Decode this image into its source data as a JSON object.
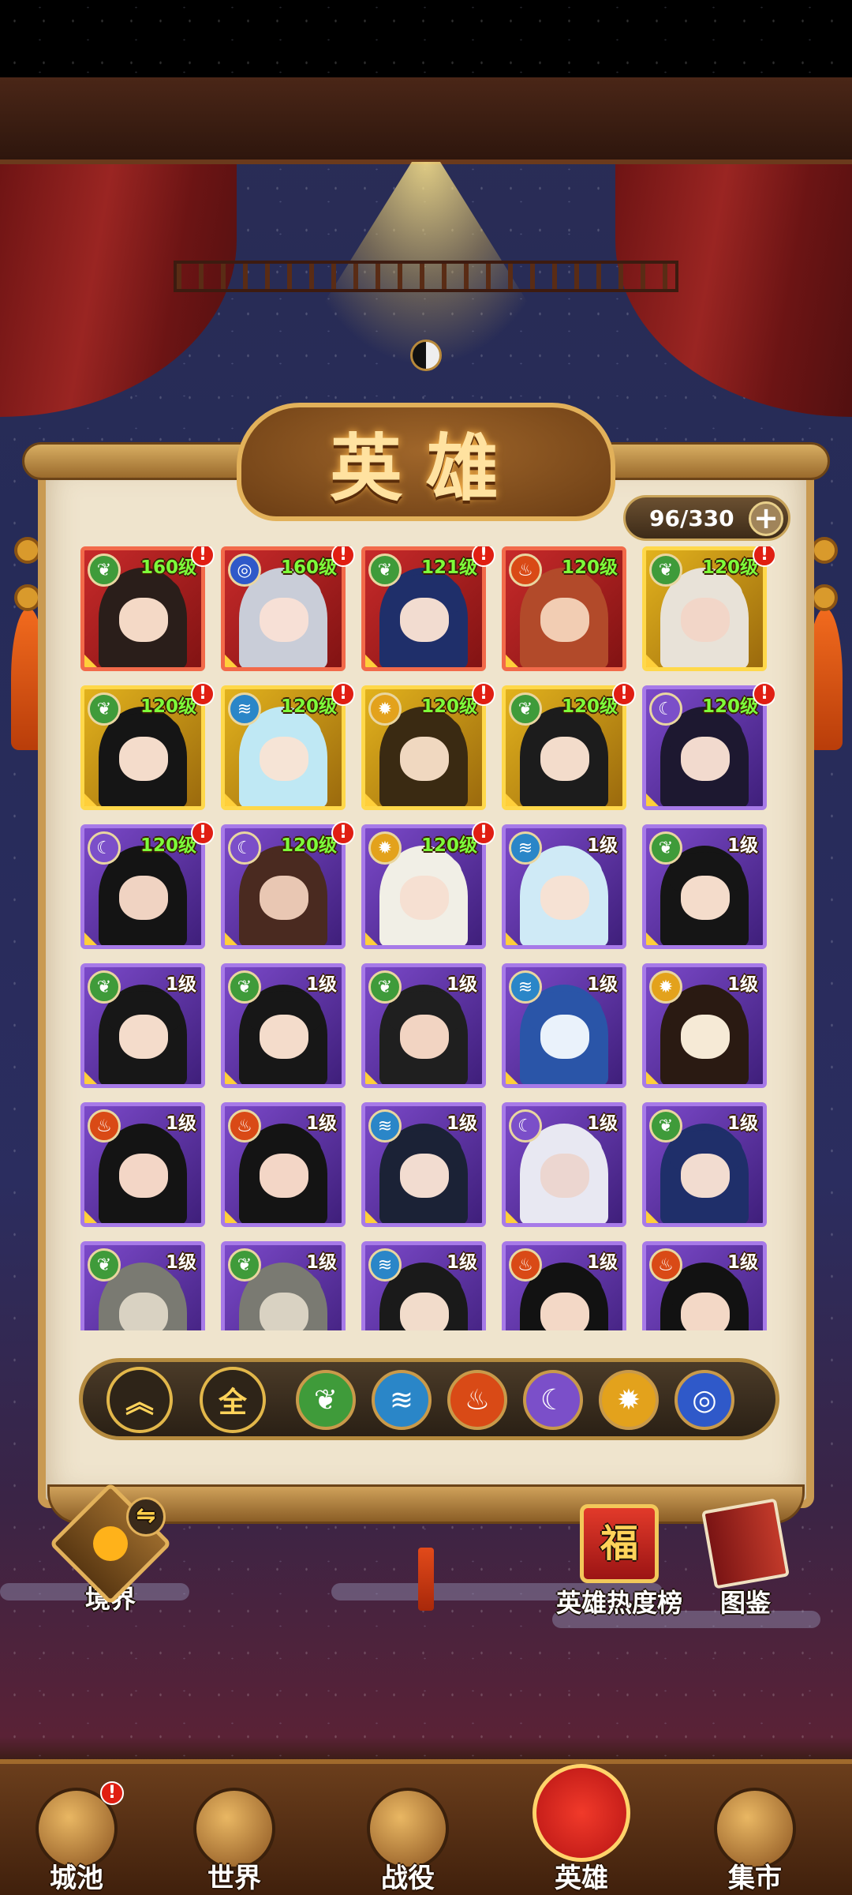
{
  "title": "英雄",
  "hero_count": "96/330",
  "add_label": "+",
  "heroes": [
    {
      "level": "160级",
      "element": "wood",
      "rarity": "red",
      "alert": true,
      "hair": "#2a1e1a",
      "skin": "#f4d9c6"
    },
    {
      "level": "160级",
      "element": "wind",
      "rarity": "red",
      "alert": true,
      "hair": "#c9cdd8",
      "skin": "#f7e0d6"
    },
    {
      "level": "121级",
      "element": "wood",
      "rarity": "red",
      "alert": true,
      "hair": "#1f2f6a",
      "skin": "#f2dcd0"
    },
    {
      "level": "120级",
      "element": "fire",
      "rarity": "red",
      "alert": false,
      "hair": "#b24a2a",
      "skin": "#f2cdb3"
    },
    {
      "level": "120级",
      "element": "wood",
      "rarity": "gold",
      "alert": true,
      "hair": "#e8e2d8",
      "skin": "#f2d6c8"
    },
    {
      "level": "120级",
      "element": "wood",
      "rarity": "gold",
      "alert": true,
      "hair": "#151515",
      "skin": "#f4dccb"
    },
    {
      "level": "120级",
      "element": "water",
      "rarity": "gold",
      "alert": true,
      "hair": "#bfe8f4",
      "skin": "#f6e4d6"
    },
    {
      "level": "120级",
      "element": "light",
      "rarity": "gold",
      "alert": true,
      "hair": "#3a2a12",
      "skin": "#f0d8c0"
    },
    {
      "level": "120级",
      "element": "wood",
      "rarity": "gold",
      "alert": true,
      "hair": "#1c1c1c",
      "skin": "#f3dccb"
    },
    {
      "level": "120级",
      "element": "dark",
      "rarity": "purple",
      "alert": true,
      "hair": "#1d1830",
      "skin": "#f2dace"
    },
    {
      "level": "120级",
      "element": "dark",
      "rarity": "purple",
      "alert": true,
      "hair": "#141414",
      "skin": "#f0d3c2"
    },
    {
      "level": "120级",
      "element": "dark",
      "rarity": "purple",
      "alert": true,
      "hair": "#4a2a20",
      "skin": "#e9c7b3"
    },
    {
      "level": "120级",
      "element": "light",
      "rarity": "purple",
      "alert": true,
      "hair": "#f1efe6",
      "skin": "#f6e0d2"
    },
    {
      "level": "1级",
      "element": "water",
      "rarity": "purple",
      "alert": false,
      "hair": "#cfeaf6",
      "skin": "#f6e2d4"
    },
    {
      "level": "1级",
      "element": "wood",
      "rarity": "purple",
      "alert": false,
      "hair": "#151515",
      "skin": "#f4dccb"
    },
    {
      "level": "1级",
      "element": "wood",
      "rarity": "purple",
      "alert": false,
      "hair": "#171717",
      "skin": "#f4dccb"
    },
    {
      "level": "1级",
      "element": "wood",
      "rarity": "purple",
      "alert": false,
      "hair": "#171717",
      "skin": "#f4dccb"
    },
    {
      "level": "1级",
      "element": "wood",
      "rarity": "purple",
      "alert": false,
      "hair": "#1f1f1f",
      "skin": "#f2d4c2"
    },
    {
      "level": "1级",
      "element": "water",
      "rarity": "purple",
      "alert": false,
      "hair": "#2a55a8",
      "skin": "#eaf2fb"
    },
    {
      "level": "1级",
      "element": "light",
      "rarity": "purple",
      "alert": false,
      "hair": "#2a1a12",
      "skin": "#f6ead6"
    },
    {
      "level": "1级",
      "element": "fire",
      "rarity": "purple",
      "alert": false,
      "hair": "#141414",
      "skin": "#f3d6c6"
    },
    {
      "level": "1级",
      "element": "fire",
      "rarity": "purple",
      "alert": false,
      "hair": "#141414",
      "skin": "#f3d6c6"
    },
    {
      "level": "1级",
      "element": "water",
      "rarity": "purple",
      "alert": false,
      "hair": "#1b2236",
      "skin": "#f2dcd0"
    },
    {
      "level": "1级",
      "element": "dark",
      "rarity": "purple",
      "alert": false,
      "hair": "#e8e8f2",
      "skin": "#ecd6d0"
    },
    {
      "level": "1级",
      "element": "wood",
      "rarity": "purple",
      "alert": false,
      "hair": "#1f2f6a",
      "skin": "#f2dcd0"
    },
    {
      "level": "1级",
      "element": "wood",
      "rarity": "purple",
      "alert": false,
      "hair": "#7a7a72",
      "skin": "#d9d2c2"
    },
    {
      "level": "1级",
      "element": "wood",
      "rarity": "purple",
      "alert": false,
      "hair": "#7a7a72",
      "skin": "#d9d2c2"
    },
    {
      "level": "1级",
      "element": "water",
      "rarity": "purple",
      "alert": false,
      "hair": "#1a1a1a",
      "skin": "#f2dccb"
    },
    {
      "level": "1级",
      "element": "fire",
      "rarity": "purple",
      "alert": false,
      "hair": "#121212",
      "skin": "#f3d8c6"
    },
    {
      "level": "1级",
      "element": "fire",
      "rarity": "purple",
      "alert": false,
      "hair": "#121212",
      "skin": "#f3d8c6"
    }
  ],
  "element_colors": {
    "wood": "#3f9b3a",
    "wind": "#2f59c9",
    "fire": "#d94a16",
    "water": "#2a86c8",
    "light": "#e3a21c",
    "dark": "#7b4fc9"
  },
  "element_icons": {
    "wood": "leaf-icon",
    "wind": "swirl-icon",
    "fire": "flame-icon",
    "water": "wave-icon",
    "light": "sun-icon",
    "dark": "moon-icon"
  },
  "filter": {
    "sort_icon": "chevrons-up-icon",
    "all_label": "全",
    "elements": [
      "wood",
      "water",
      "fire",
      "dark",
      "light",
      "wind"
    ]
  },
  "side": {
    "realm": "境界",
    "ranking": "英雄热度榜",
    "codex": "图鉴"
  },
  "nav": [
    {
      "label": "城池",
      "icon": "city-gate-icon",
      "alert": true,
      "active": false
    },
    {
      "label": "世界",
      "icon": "mountain-icon",
      "alert": false,
      "active": false
    },
    {
      "label": "战役",
      "icon": "crossed-swords-icon",
      "alert": false,
      "active": false
    },
    {
      "label": "英雄",
      "icon": "hero-portrait-icon",
      "alert": false,
      "active": true
    },
    {
      "label": "集市",
      "icon": "market-cart-icon",
      "alert": false,
      "active": false
    }
  ]
}
